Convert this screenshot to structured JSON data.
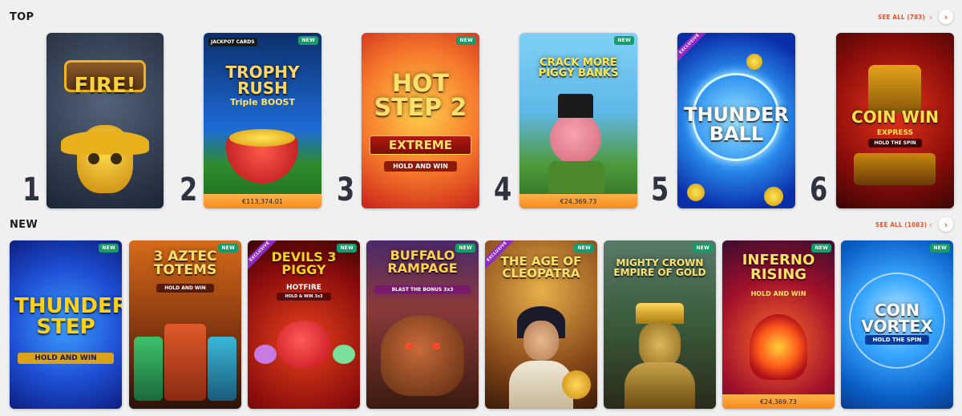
{
  "sections": {
    "top": {
      "title": "TOP",
      "see_all": "SEE ALL (783)",
      "ranks": [
        "1",
        "2",
        "3",
        "4",
        "5",
        "6"
      ],
      "tiles": [
        {
          "name": "FIRE!",
          "badge": "",
          "jackpot": "",
          "colors": [
            "#2d3a4e",
            "#54637a"
          ],
          "accent": "#f0b419"
        },
        {
          "name": "TROPHY RUSH",
          "subtitle": "Triple BOOST",
          "brand": "JACKPOT CARDS",
          "badge": "NEW",
          "jackpot": "€113,374.01",
          "colors": [
            "#0c2f6b",
            "#1e6bd6"
          ],
          "accent": "#e3a91d"
        },
        {
          "name": "HOT STEP 2",
          "subtitle": "EXTREME",
          "tagline": "HOLD AND WIN",
          "badge": "NEW",
          "jackpot": "",
          "colors": [
            "#f5a52b",
            "#d9361c"
          ],
          "accent": "#ffe06b"
        },
        {
          "name": "CRACK MORE PIGGY BANKS",
          "badge": "NEW",
          "jackpot": "€24,369.73",
          "colors": [
            "#5fb8e8",
            "#3c8e43"
          ],
          "accent": "#ff5fa2"
        },
        {
          "name": "THUNDER BALL",
          "badge": "EXCLUSIVE",
          "jackpot": "",
          "colors": [
            "#0a2ea8",
            "#3dc5ff"
          ],
          "accent": "#ffd21a"
        },
        {
          "name": "COIN WIN",
          "subtitle": "EXPRESS",
          "tagline": "HOLD THE SPIN",
          "badge": "",
          "jackpot": "",
          "colors": [
            "#4a0707",
            "#c0180f"
          ],
          "accent": "#f2b51b"
        }
      ]
    },
    "new": {
      "title": "NEW",
      "see_all": "SEE ALL (1083)",
      "tiles": [
        {
          "name": "THUNDER STEP",
          "tagline": "HOLD AND WIN",
          "badge": "NEW",
          "jackpot": "",
          "colors": [
            "#0d2aa0",
            "#2b72ea"
          ],
          "accent": "#ffd21a"
        },
        {
          "name": "3 AZTEC TOTEMS",
          "tagline": "HOLD AND WIN",
          "badge": "NEW",
          "jackpot": "",
          "colors": [
            "#c35a1a",
            "#3d1a0c"
          ],
          "accent": "#ffc93a"
        },
        {
          "name": "DEVILS 3 PIGGY",
          "subtitle": "HOTFIRE",
          "tagline": "HOLD & WIN 3x3",
          "badge": "EXCLUSIVE",
          "badge2": "NEW",
          "jackpot": "",
          "colors": [
            "#7a0c0c",
            "#d82a22"
          ],
          "accent": "#ffd21a"
        },
        {
          "name": "BUFFALO RAMPAGE",
          "tagline": "BLAST THE BONUS 3x3",
          "badge": "NEW",
          "jackpot": "",
          "colors": [
            "#3a1a3a",
            "#a4401a"
          ],
          "accent": "#ffcf2e"
        },
        {
          "name": "THE AGE OF CLEOPATRA",
          "badge": "EXCLUSIVE",
          "badge2": "NEW",
          "jackpot": "",
          "colors": [
            "#5a2e10",
            "#c98a3b"
          ],
          "accent": "#ffd85a"
        },
        {
          "name": "MIGHTY CROWN EMPIRE OF GOLD",
          "badge": "NEW",
          "jackpot": "",
          "colors": [
            "#2a3f2a",
            "#8a7a3a"
          ],
          "accent": "#ffd85a"
        },
        {
          "name": "INFERNO RISING",
          "tagline": "HOLD AND WIN",
          "badge": "NEW",
          "jackpot": "€24,369.73",
          "colors": [
            "#3a0d30",
            "#b5162c"
          ],
          "accent": "#ff8a2a"
        },
        {
          "name": "COIN VORTEX",
          "tagline": "HOLD THE SPIN",
          "badge": "NEW",
          "jackpot": "",
          "colors": [
            "#0a5fc7",
            "#2aa8ff"
          ],
          "accent": "#ffffff"
        }
      ]
    }
  },
  "nav": {
    "prev": "‹",
    "next": "›"
  }
}
